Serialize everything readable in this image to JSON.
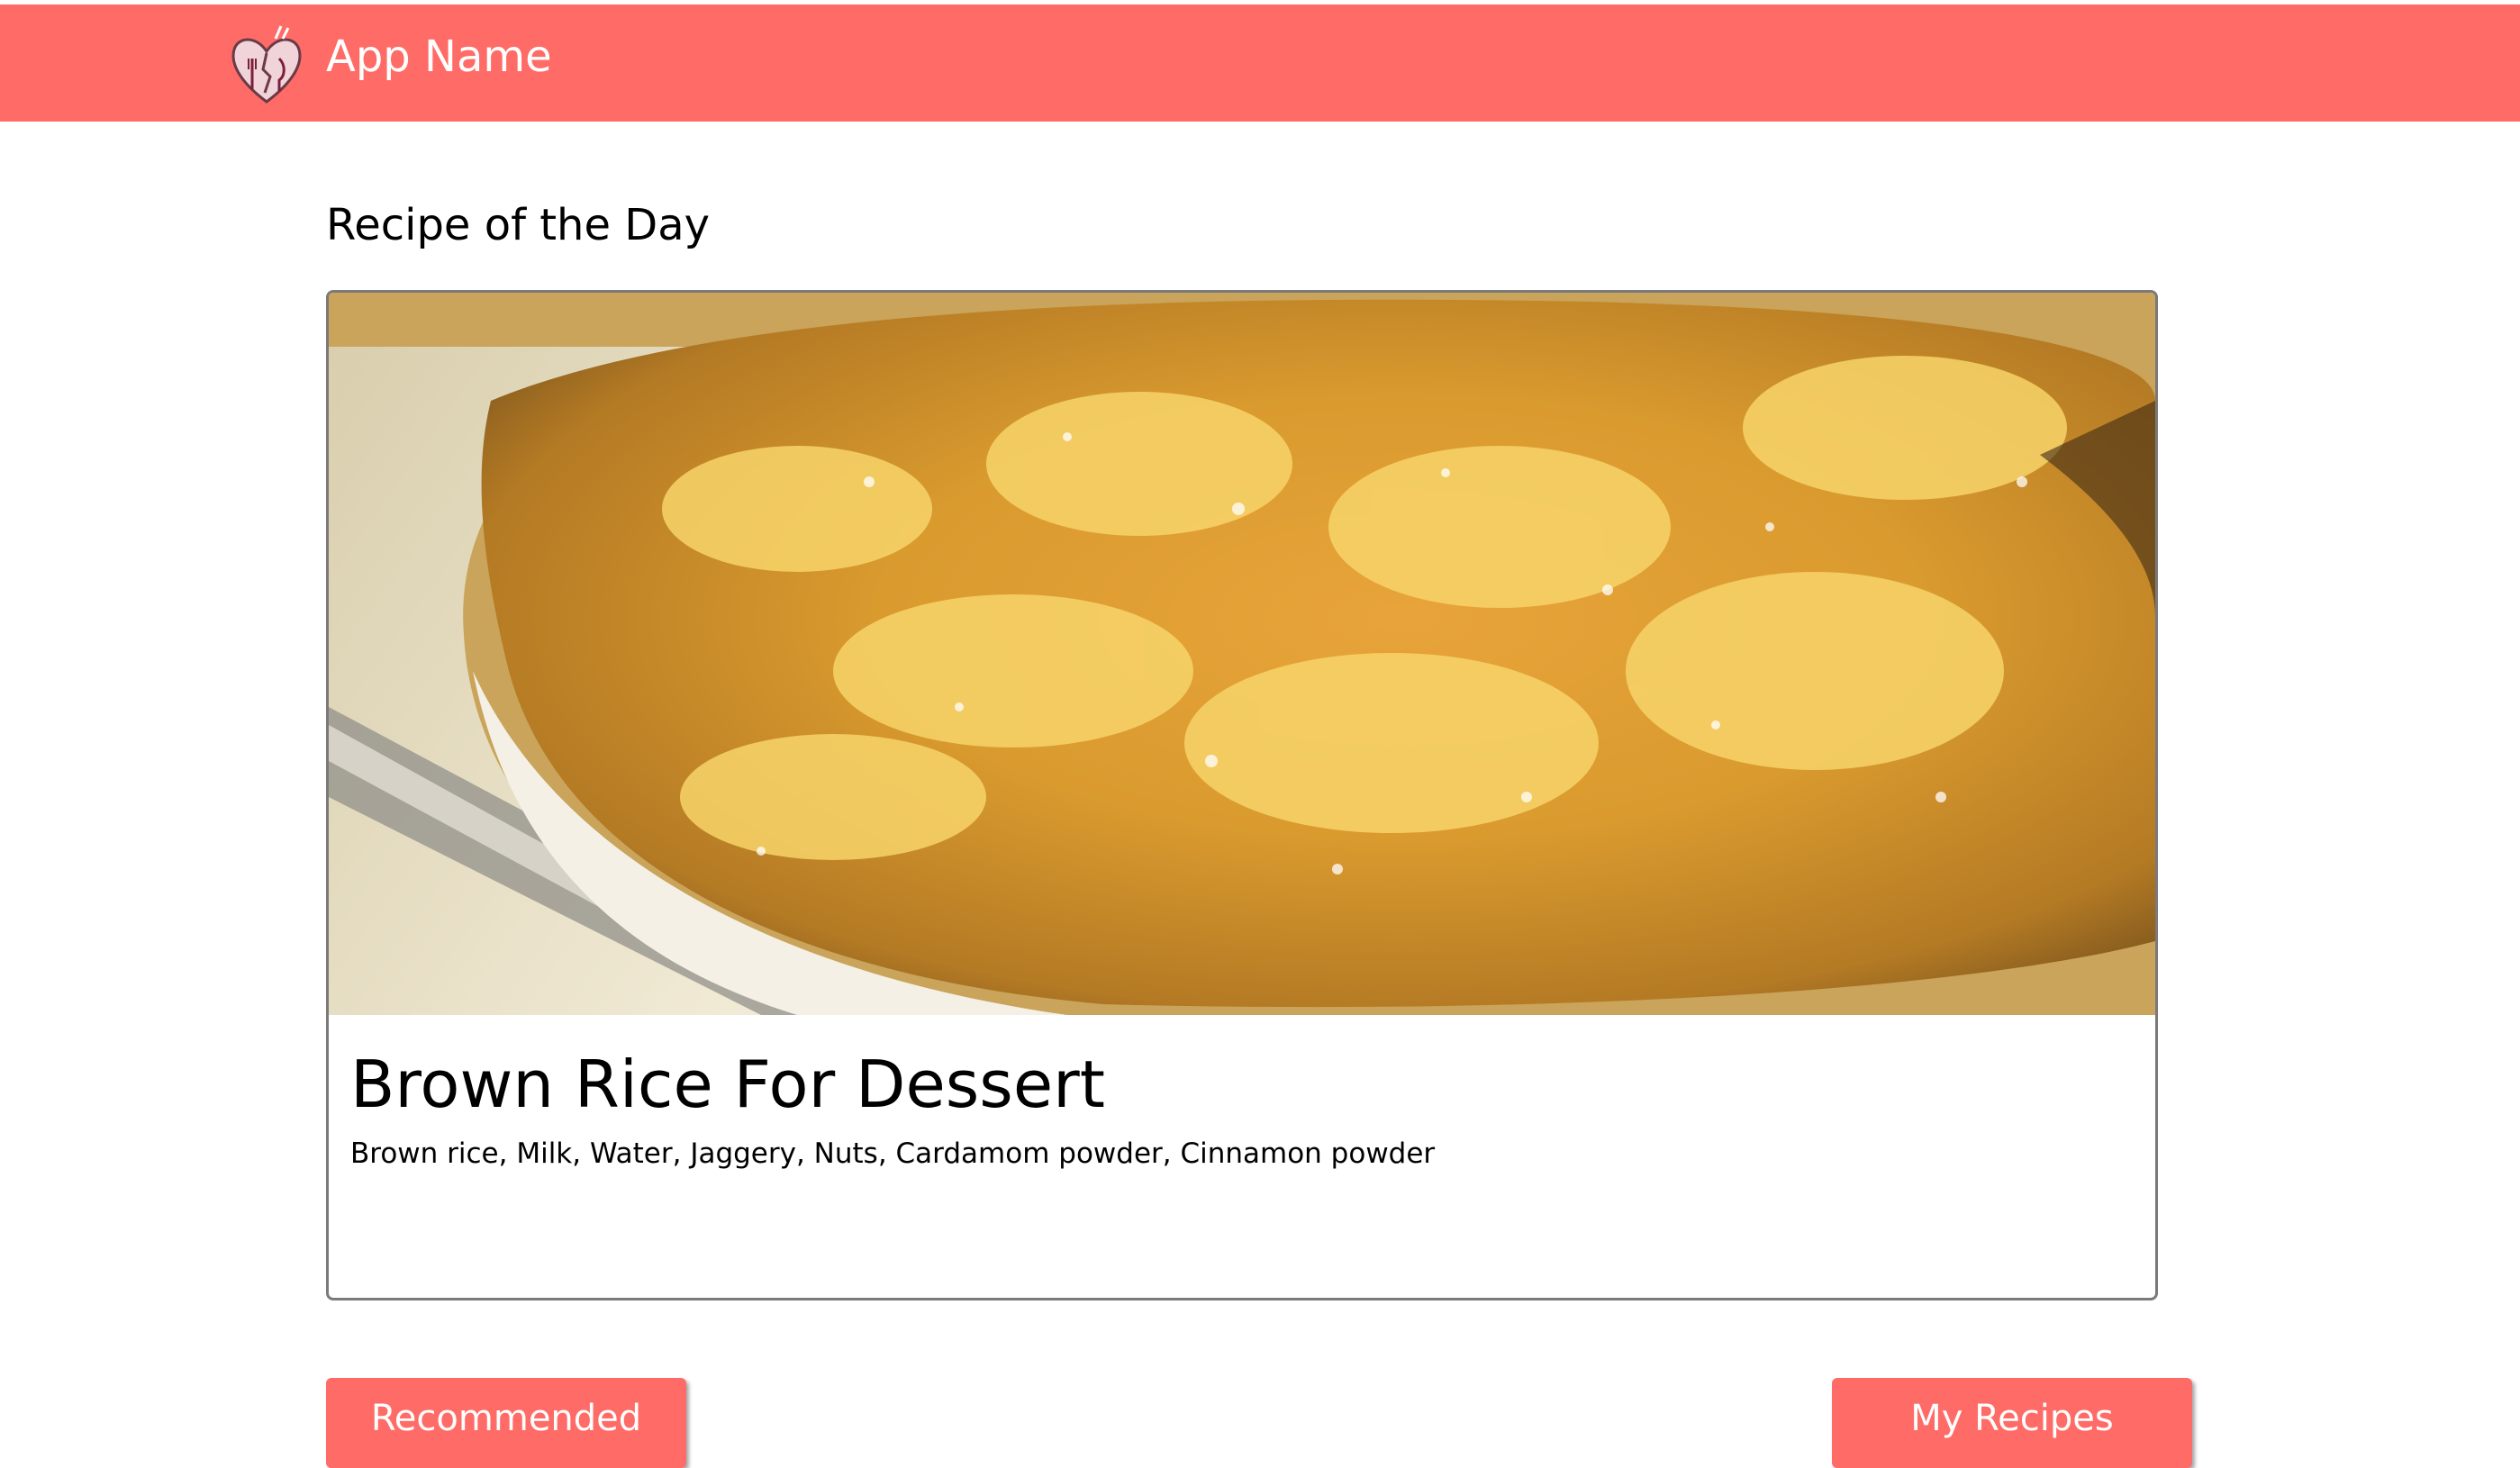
{
  "header": {
    "app_name": "App Name",
    "logo_icon": "heart-fork-logo-icon",
    "background": "#ff6b66"
  },
  "main": {
    "section_title": "Recipe of the Day",
    "recipe": {
      "image_icon": "dessert-photo",
      "title": "Brown Rice For Dessert",
      "ingredients": "Brown rice, Milk, Water, Jaggery, Nuts, Cardamom powder, Cinnamon powder"
    }
  },
  "actions": {
    "recommended_label": "Recommended",
    "my_recipes_label": "My Recipes",
    "accent": "#ff6b66"
  }
}
